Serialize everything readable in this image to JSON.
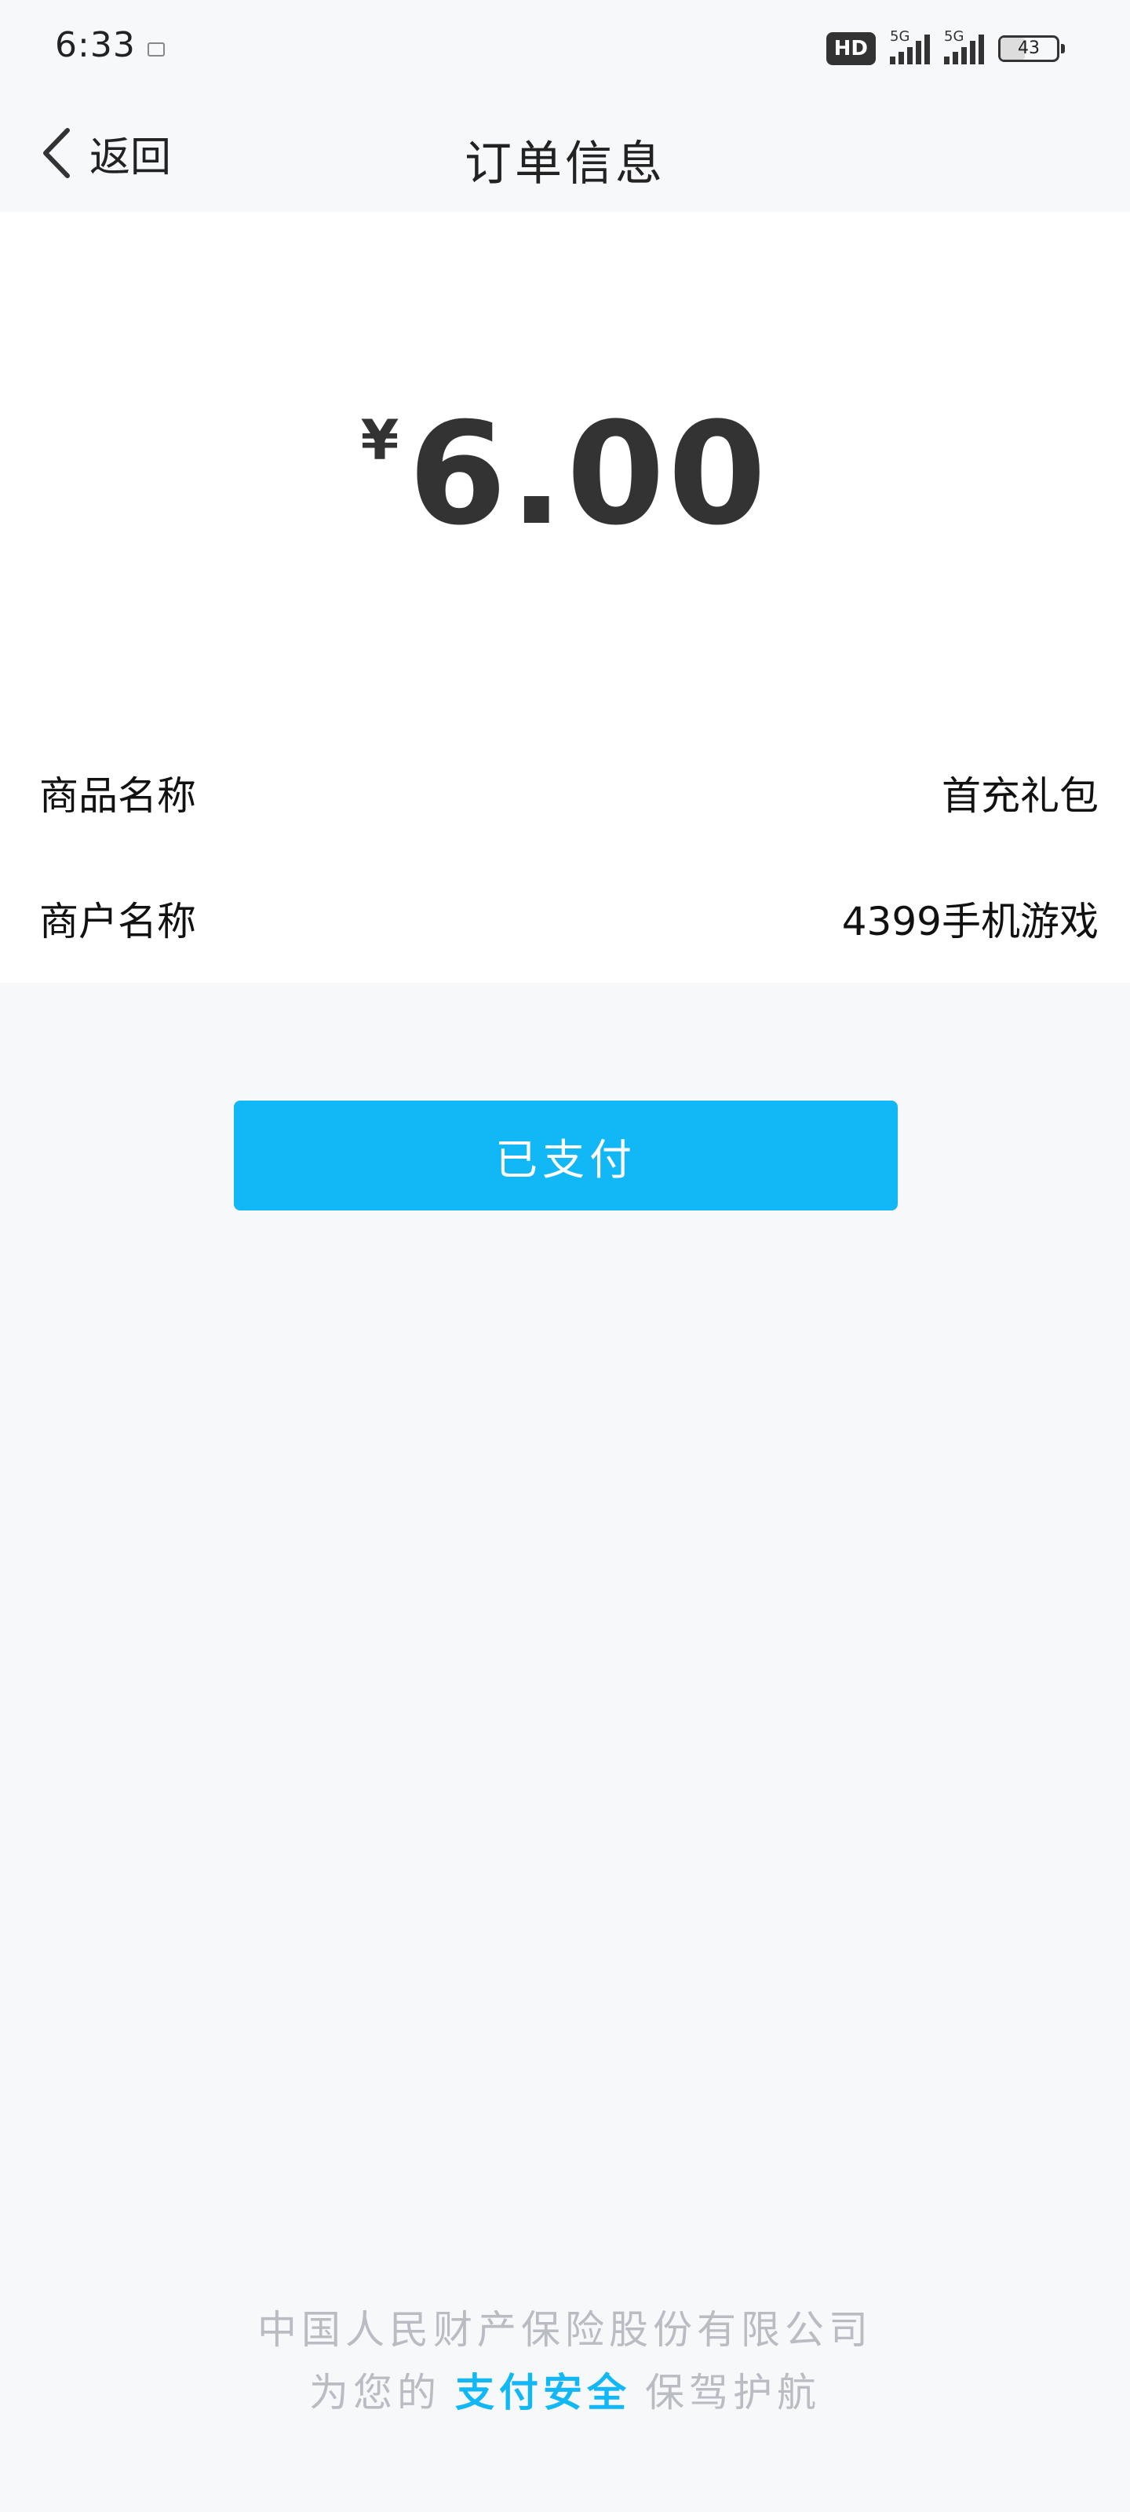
{
  "status_bar": {
    "time": "6:33",
    "network_badge": "HD",
    "signal_1_tag": "5G",
    "signal_2_tag": "5G",
    "battery_level": "43"
  },
  "header": {
    "back_label": "返回",
    "title": "订单信息"
  },
  "order": {
    "currency_symbol": "¥",
    "amount": "6.00",
    "rows": [
      {
        "label": "商品名称",
        "value": "首充礼包"
      },
      {
        "label": "商户名称",
        "value": "4399手机游戏"
      }
    ]
  },
  "paid_button_label": "已支付",
  "footer": {
    "line1": "中国人民财产保险股份有限公司",
    "line2_prefix": "为您的",
    "line2_highlight": "支付安全",
    "line2_suffix": "保驾护航"
  },
  "colors": {
    "accent": "#12b7f5",
    "background": "#f7f8fa",
    "card": "#ffffff"
  }
}
